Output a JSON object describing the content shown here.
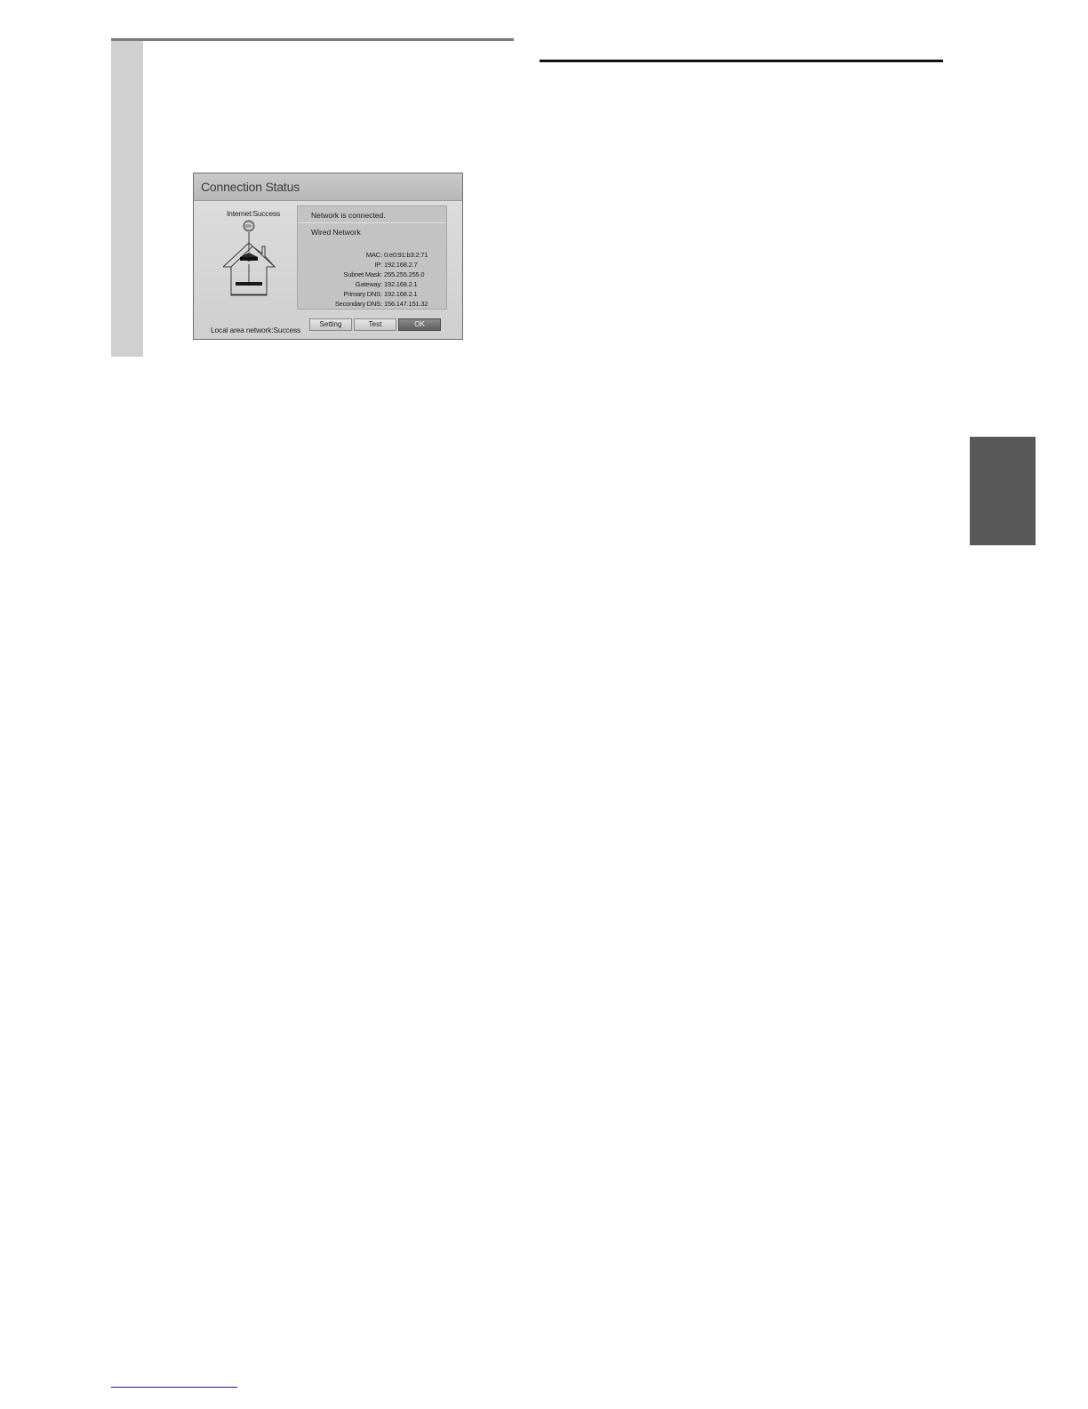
{
  "dialog": {
    "title": "Connection Status",
    "diagram": {
      "internet_label": "Internet:Success",
      "lan_label": "Local area network:Success"
    },
    "status_text": "Network is connected.",
    "network_type": "Wired Network",
    "details": [
      {
        "key": "MAC",
        "value": "0:e0:91:b3:2:71"
      },
      {
        "key": "IP",
        "value": "192.168.2.7"
      },
      {
        "key": "Subnet Mask",
        "value": "255.255.255.0"
      },
      {
        "key": "Gateway",
        "value": "192.168.2.1"
      },
      {
        "key": "Primary DNS",
        "value": "192.168.2.1"
      },
      {
        "key": "Secondary DNS",
        "value": "156.147.151.32"
      }
    ],
    "buttons": {
      "setting": "Setting",
      "test": "Test",
      "ok": "OK"
    }
  }
}
